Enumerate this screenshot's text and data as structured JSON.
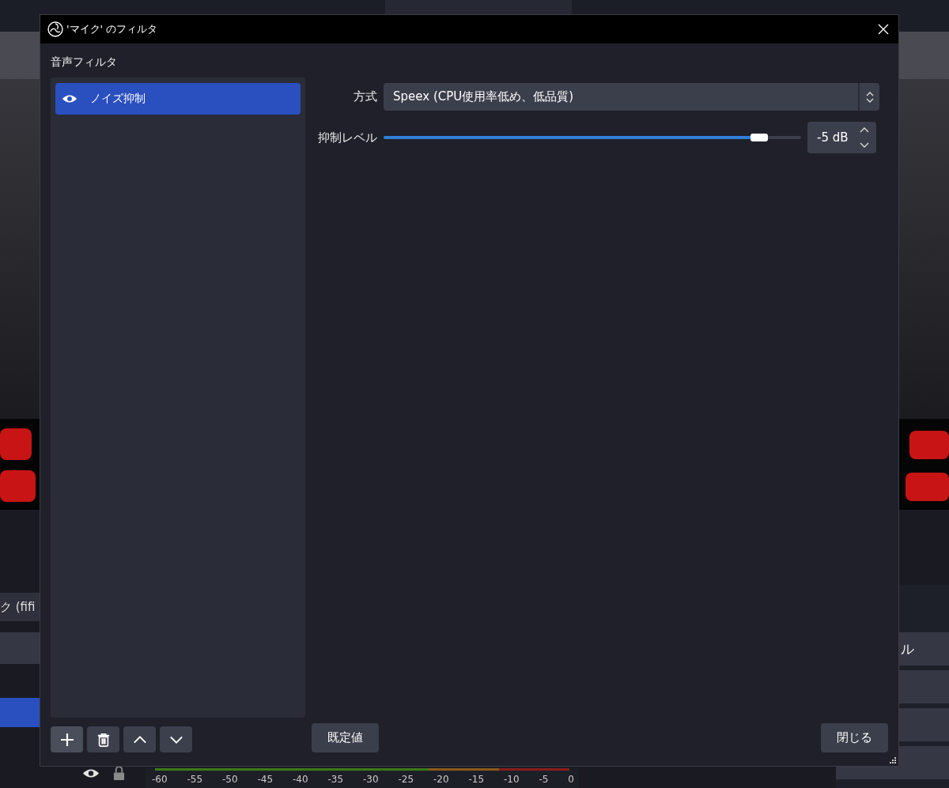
{
  "background": {
    "source_field": "ク (fifi",
    "side_button": "ル",
    "meter_ticks": [
      "-60",
      "-55",
      "-50",
      "-45",
      "-40",
      "-35",
      "-30",
      "-25",
      "-20",
      "-15",
      "-10",
      "-5",
      "0"
    ]
  },
  "window": {
    "title": "'マイク' のフィルタ"
  },
  "filters_panel": {
    "label": "音声フィルタ",
    "items": [
      {
        "name": "ノイズ抑制",
        "visible": true,
        "selected": true
      }
    ]
  },
  "properties": [
    {
      "kind": "combo",
      "label": "方式",
      "value": "Speex (CPU使用率低め、低品質)"
    },
    {
      "kind": "slider",
      "label": "抑制レベル",
      "level": 0.9,
      "value": "-5 dB"
    }
  ],
  "buttons": {
    "defaults": "既定値",
    "close": "閉じる"
  }
}
